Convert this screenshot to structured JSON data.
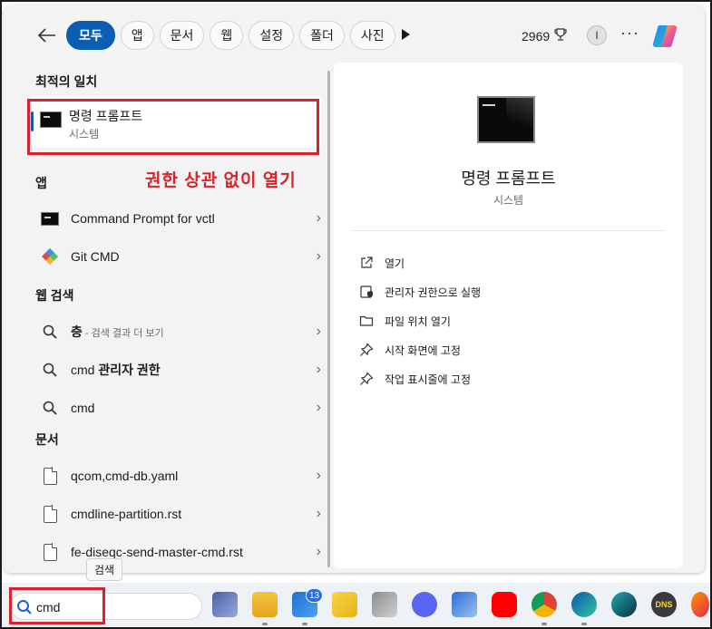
{
  "topbar": {
    "filters": [
      "모두",
      "앱",
      "문서",
      "웹",
      "설정",
      "폴더",
      "사진"
    ],
    "points": "2969",
    "profile_initial": "I",
    "overflow": "···"
  },
  "best_match": {
    "section_title": "최적의 일치",
    "title": "명령 프롬프트",
    "subtitle": "시스템"
  },
  "annotation": "권한 상관 없이 열기",
  "apps": {
    "section_title": "앱",
    "items": [
      {
        "label": "Command Prompt for vctl",
        "icon": "cmd-icon"
      },
      {
        "label": "Git CMD",
        "icon": "git-icon"
      }
    ]
  },
  "web": {
    "section_title": "웹 검색",
    "items": [
      {
        "bold": "층",
        "rest": " - 검색 결과 더 보기"
      },
      {
        "plain": "cmd ",
        "bold": "관리자 권한"
      },
      {
        "plain": "cmd"
      }
    ]
  },
  "documents": {
    "section_title": "문서",
    "items": [
      "qcom,cmd-db.yaml",
      "cmdline-partition.rst",
      "fe-diseqc-send-master-cmd.rst"
    ]
  },
  "preview": {
    "title": "명령 프롬프트",
    "subtitle": "시스템",
    "actions": [
      {
        "label": "열기",
        "icon": "open-external-icon"
      },
      {
        "label": "관리자 권한으로 실행",
        "icon": "admin-shield-icon"
      },
      {
        "label": "파일 위치 열기",
        "icon": "folder-icon"
      },
      {
        "label": "시작 화면에 고정",
        "icon": "pin-icon"
      },
      {
        "label": "작업 표시줄에 고정",
        "icon": "pin-icon"
      }
    ]
  },
  "taskbar": {
    "search_value": "cmd",
    "tooltip": "검색",
    "mail_badge": "13",
    "dns_label": "DNS"
  }
}
